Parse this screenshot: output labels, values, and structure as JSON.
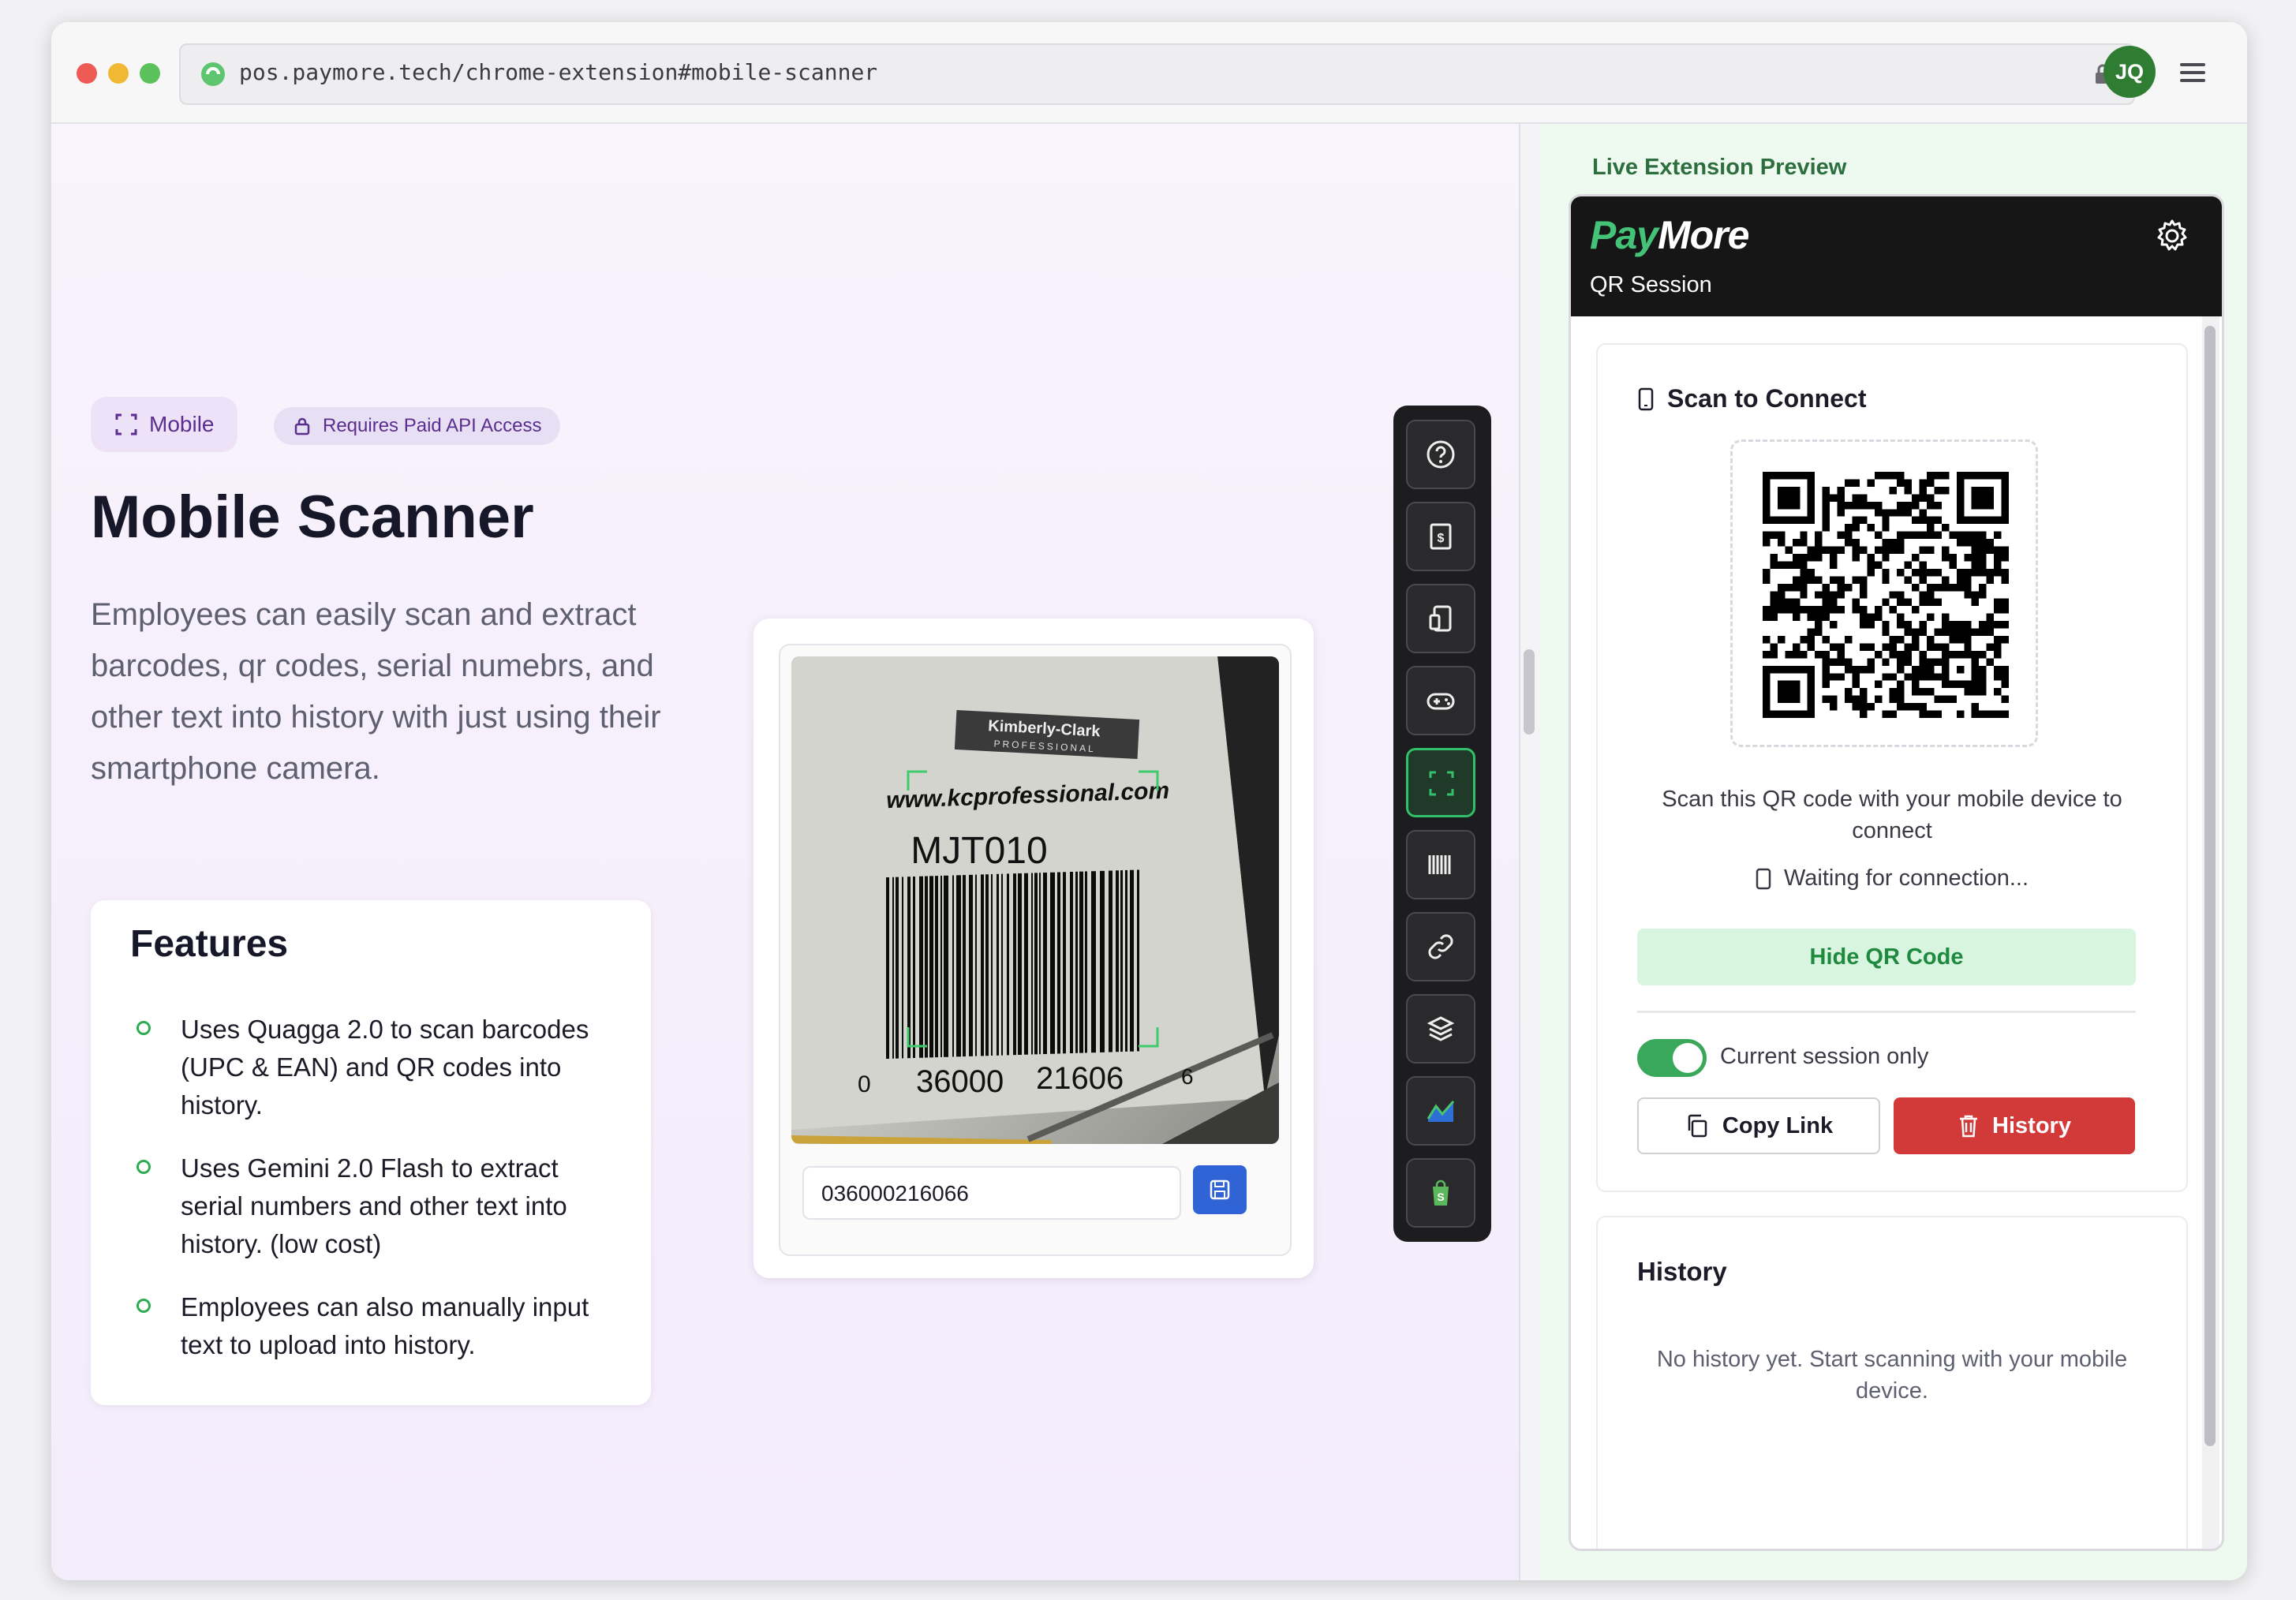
{
  "browser": {
    "url": "pos.paymore.tech/chrome-extension#mobile-scanner",
    "avatar_initials": "JQ"
  },
  "main": {
    "tag_mobile": "Mobile",
    "tag_paid": "Requires Paid API Access",
    "title": "Mobile Scanner",
    "description": "Employees can easily scan and extract barcodes, qr codes, serial numebrs, and other text into history with just using their smartphone camera.",
    "features": {
      "heading": "Features",
      "items": [
        "Uses Quagga 2.0 to scan barcodes (UPC & EAN) and QR codes into history.",
        "Uses Gemini 2.0 Flash to extract serial numbers and other text into history. (low cost)",
        "Employees can also manually input text to upload into history."
      ]
    },
    "scanner": {
      "photo_text": {
        "brand": "Kimberly-Clark",
        "brand_sub": "PROFESSIONAL",
        "website": "www.kcprofessional.com",
        "model": "MJT010",
        "barcode_left": "0",
        "barcode_mid1": "36000",
        "barcode_mid2": "21606",
        "barcode_right": "6"
      },
      "code_value": "036000216066"
    },
    "toolbar": {
      "buttons": [
        "help-icon",
        "receipt-icon",
        "devices-icon",
        "gamepad-icon",
        "scan-icon",
        "barcode-icon",
        "link-icon",
        "layers-icon",
        "chart-icon",
        "shopify-icon"
      ],
      "active": "scan-icon"
    }
  },
  "preview": {
    "label": "Live Extension Preview",
    "brand_pay": "Pay",
    "brand_more": "More",
    "subtitle": "QR Session",
    "connect_title": "Scan to Connect",
    "scan_hint": "Scan this QR code with your mobile device to connect",
    "waiting": "Waiting for connection...",
    "hide_qr": "Hide QR Code",
    "toggle_label": "Current session only",
    "toggle_on": true,
    "copy_link": "Copy Link",
    "history_button": "History",
    "history_heading": "History",
    "history_empty": "No history yet. Start scanning with your mobile device."
  },
  "colors": {
    "accent_green": "#32c06a",
    "danger_red": "#d23a3a",
    "brand_purple": "#5b2d8e",
    "save_blue": "#2f63d6"
  }
}
